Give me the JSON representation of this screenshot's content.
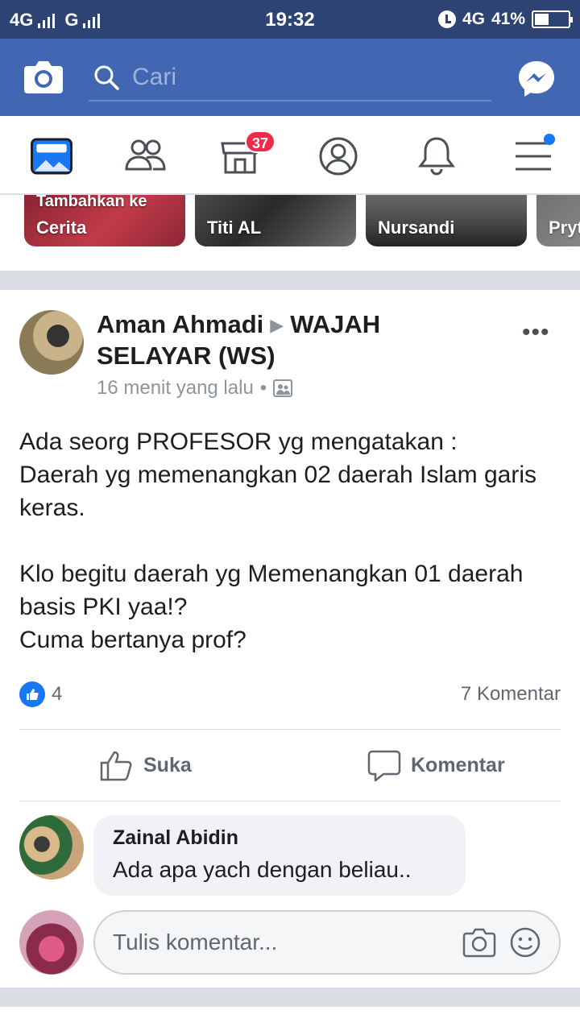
{
  "status_bar": {
    "left": "4G",
    "left2": "G",
    "time": "19:32",
    "network": "4G",
    "battery": "41%"
  },
  "header": {
    "search_placeholder": "Cari"
  },
  "nav": {
    "marketplace_badge": "37"
  },
  "stories": [
    {
      "label": "Cerita",
      "top_label": "Tambahkan ke"
    },
    {
      "label": "Titi AL"
    },
    {
      "label": "Nursandi"
    },
    {
      "label": "Pryt"
    }
  ],
  "post": {
    "author": "Aman Ahmadi",
    "group": "WAJAH SELAYAR (WS)",
    "time": "16 menit yang lalu",
    "separator": "•",
    "text": "Ada seorg PROFESOR yg mengatakan :\nDaerah yg memenangkan  02 daerah Islam garis keras.\n\nKlo begitu daerah yg Memenangkan 01 daerah basis PKI  yaa!?\nCuma bertanya prof?",
    "like_count": "4",
    "comment_count": "7 Komentar",
    "like_label": "Suka",
    "comment_label": "Komentar"
  },
  "comments": [
    {
      "name": "Zainal Abidin",
      "text": "Ada apa yach dengan beliau.."
    }
  ],
  "write_comment": {
    "placeholder": "Tulis komentar..."
  },
  "colors": {
    "header": "#4267b2",
    "status": "#2d4373",
    "badge": "#f02849",
    "like": "#1877f2"
  }
}
